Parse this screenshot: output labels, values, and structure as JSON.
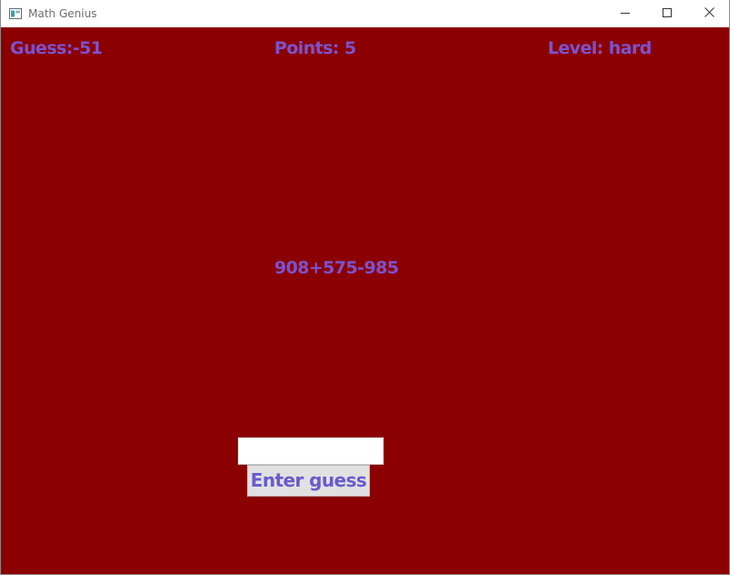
{
  "window": {
    "title": "Math Genius",
    "icon": "app-window-icon",
    "controls": [
      "minimize-icon",
      "maximize-icon",
      "close-icon"
    ]
  },
  "hud": {
    "guess": "Guess:-51",
    "points": "Points: 5",
    "level": "Level: hard"
  },
  "problem": {
    "expression": "908+575-985"
  },
  "answer_input": {
    "value": "",
    "placeholder": ""
  },
  "enter_button": {
    "label": "Enter guess"
  },
  "colors": {
    "background": "#8b0000",
    "text": "#7b52cf",
    "button_text": "#6a5acd",
    "button_face": "#e1e1e1"
  }
}
